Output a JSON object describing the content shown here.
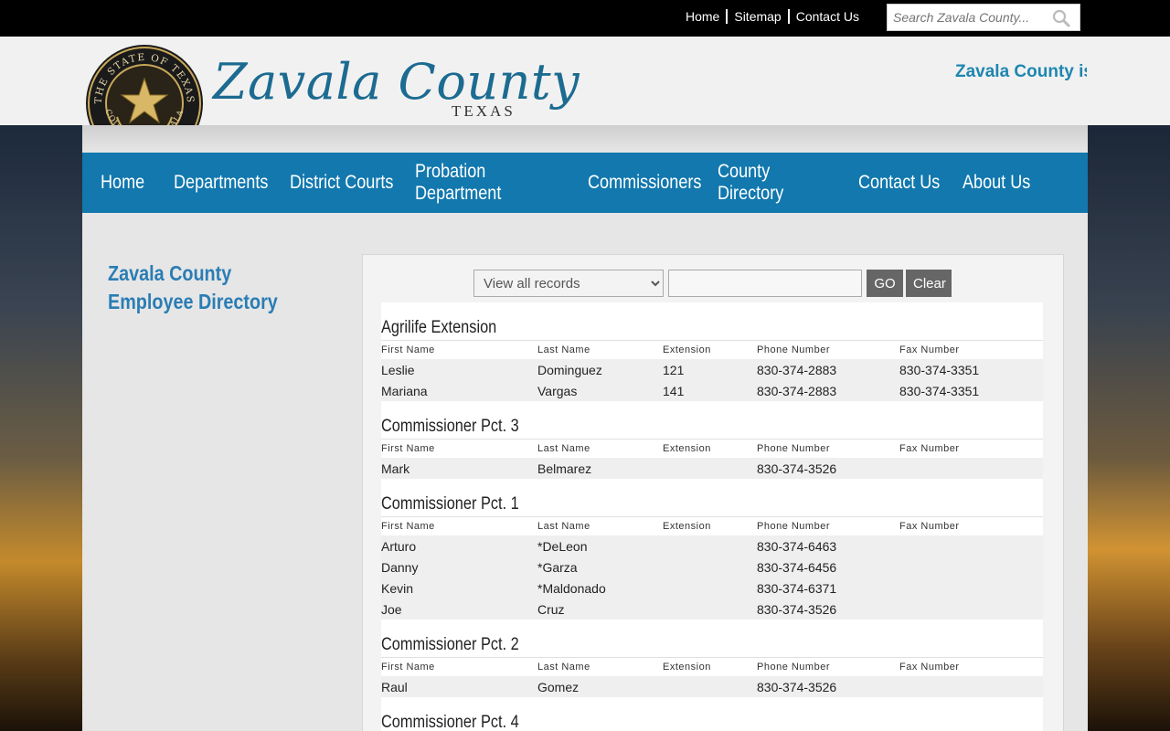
{
  "top": {
    "links": [
      "Home",
      "Sitemap",
      "Contact Us"
    ],
    "search_placeholder": "Search Zavala County..."
  },
  "header": {
    "title": "Zavala County",
    "subtitle": "TEXAS",
    "seal_text": "THE STATE OF TEXAS · COUNTY OF ZAVALA",
    "marquee": "Zavala County is"
  },
  "nav": [
    "Home",
    "Departments",
    "District Courts",
    "Probation Department",
    "Commissioners",
    "County Directory",
    "Contact Us",
    "About Us"
  ],
  "sidebar": {
    "title_line1": "Zavala County",
    "title_line2": "Employee Directory"
  },
  "controls": {
    "select_value": "View all records",
    "go": "GO",
    "clear": "Clear"
  },
  "columns": [
    "First Name",
    "Last Name",
    "Extension",
    "Phone Number",
    "Fax Number"
  ],
  "sections": [
    {
      "title": "Agrilife Extension",
      "rows": [
        [
          "Leslie",
          "Dominguez",
          "121",
          "830-374-2883",
          "830-374-3351"
        ],
        [
          "Mariana",
          "Vargas",
          "141",
          "830-374-2883",
          "830-374-3351"
        ]
      ]
    },
    {
      "title": "Commissioner Pct. 3",
      "rows": [
        [
          "Mark",
          "Belmarez",
          "",
          "830-374-3526",
          ""
        ]
      ]
    },
    {
      "title": "Commissioner Pct. 1",
      "rows": [
        [
          "Arturo",
          "*DeLeon",
          "",
          "830-374-6463",
          ""
        ],
        [
          "Danny",
          "*Garza",
          "",
          "830-374-6456",
          ""
        ],
        [
          "Kevin",
          "*Maldonado",
          "",
          "830-374-6371",
          ""
        ],
        [
          "Joe",
          "Cruz",
          "",
          "830-374-3526",
          ""
        ]
      ]
    },
    {
      "title": "Commissioner Pct. 2",
      "rows": [
        [
          "Raul",
          "Gomez",
          "",
          "830-374-3526",
          ""
        ]
      ]
    },
    {
      "title": "Commissioner Pct. 4",
      "rows": []
    }
  ],
  "colors": {
    "nav_blue": "#1278ae",
    "title_blue": "#1c6b91",
    "link_blue": "#2a7db4"
  }
}
